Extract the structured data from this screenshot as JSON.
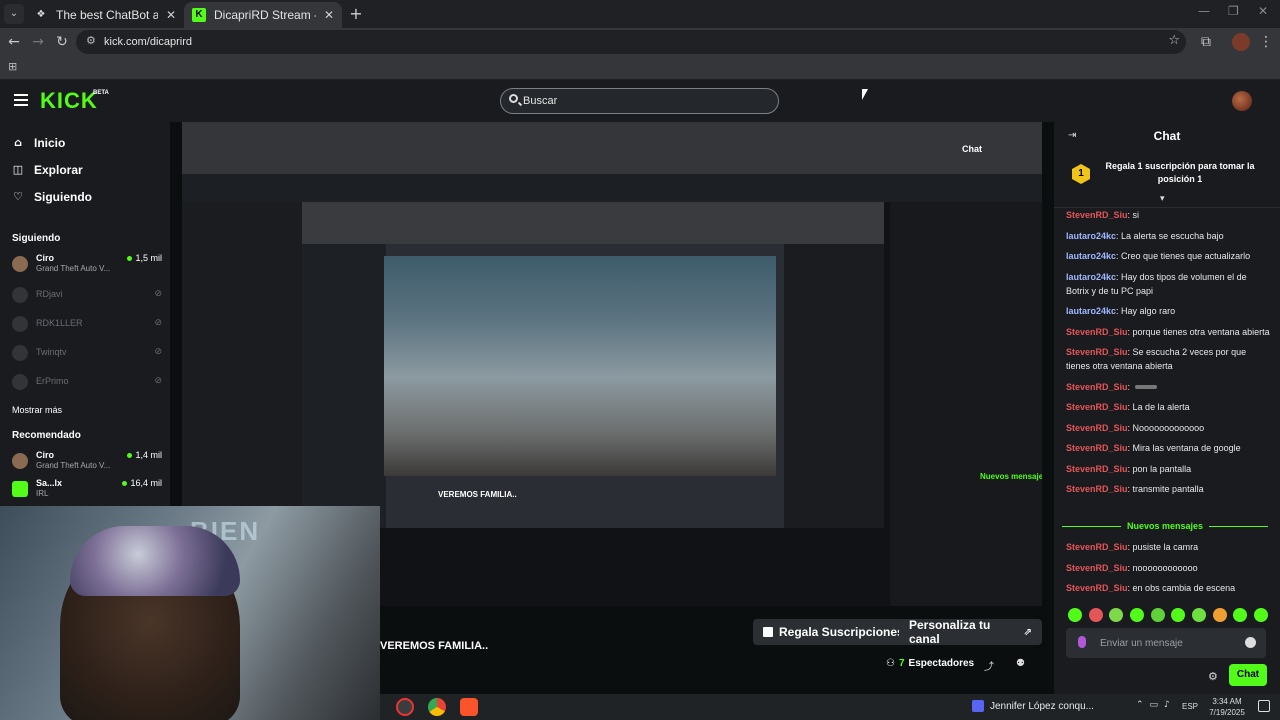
{
  "browser": {
    "tabs": [
      {
        "label": "The best ChatBot and Widgets",
        "close": "✕"
      },
      {
        "label": "DicapriRD Stream - Watch Live",
        "close": "✕"
      }
    ],
    "new_tab": "+",
    "url": "kick.com/dicaprird"
  },
  "header": {
    "logo": "KICK",
    "logo_badge": "BETA",
    "search_placeholder": "Buscar"
  },
  "sidebar": {
    "nav": [
      {
        "label": "Inicio",
        "icon": "home-icon",
        "glyph": "⌂"
      },
      {
        "label": "Explorar",
        "icon": "compass-icon",
        "glyph": "◫"
      },
      {
        "label": "Siguiendo",
        "icon": "heart-icon",
        "glyph": "♡"
      }
    ],
    "following_heading": "Siguiendo",
    "following": [
      {
        "name": "Ciro",
        "game": "Grand Theft Auto V...",
        "viewers": "1,5 mil",
        "live": true
      },
      {
        "name": "RDjavi",
        "live": false
      },
      {
        "name": "RDK1LLER",
        "live": false
      },
      {
        "name": "Twinqtv",
        "live": false
      },
      {
        "name": "ErPrimo",
        "live": false
      }
    ],
    "show_more": "Mostrar más",
    "recommended_heading": "Recomendado",
    "recommended": [
      {
        "name": "Ciro",
        "game": "Grand Theft Auto V...",
        "viewers": "1,4 mil"
      },
      {
        "name": "Sa...lx",
        "game": "IRL",
        "viewers": "16,4 mil"
      }
    ]
  },
  "stream": {
    "title": "VEREMOS FAMILIA..",
    "gift_button": "Regala Suscripciones",
    "customize_button": "Personaliza tu canal",
    "viewers_count": "7",
    "viewers_label": "Espectadores",
    "overlay_text": "BIEN",
    "nested_title": "VEREMOS FAMILIA.."
  },
  "chat": {
    "title": "Chat",
    "pinned_rank": "1",
    "pinned_text": "Regala 1 suscripción para tomar la posición 1",
    "messages": [
      {
        "user": "StevenRD_Siu",
        "color": "red",
        "text": "si"
      },
      {
        "user": "lautaro24kc",
        "color": "blue",
        "text": "La alerta se escucha bajo"
      },
      {
        "user": "lautaro24kc",
        "color": "blue",
        "text": "Creo que tienes que actualizarlo"
      },
      {
        "user": "lautaro24kc",
        "color": "blue",
        "text": "Hay dos tipos de volumen el de Botrix y de tu PC papi"
      },
      {
        "user": "lautaro24kc",
        "color": "blue",
        "text": "Hay algo raro"
      },
      {
        "user": "StevenRD_Siu",
        "color": "red",
        "text": "porque tienes otra ventana abierta"
      },
      {
        "user": "StevenRD_Siu",
        "color": "red",
        "text": "Se escucha 2 veces por que tienes otra ventana abierta"
      },
      {
        "user": "StevenRD_Siu",
        "color": "red",
        "text": ""
      },
      {
        "user": "StevenRD_Siu",
        "color": "red",
        "text": "La de la alerta"
      },
      {
        "user": "StevenRD_Siu",
        "color": "red",
        "text": "Nooooooooooooo"
      },
      {
        "user": "StevenRD_Siu",
        "color": "red",
        "text": "Mira las ventana de google"
      },
      {
        "user": "StevenRD_Siu",
        "color": "red",
        "text": "pon la pantalla"
      },
      {
        "user": "StevenRD_Siu",
        "color": "red",
        "text": "transmite pantalla"
      }
    ],
    "new_messages_label": "Nuevos mensajes",
    "new_messages": [
      {
        "user": "StevenRD_Siu",
        "color": "red",
        "text": "pusiste la camra"
      },
      {
        "user": "StevenRD_Siu",
        "color": "red",
        "text": "noooooooooooo"
      },
      {
        "user": "StevenRD_Siu",
        "color": "red",
        "text": "en obs cambia de escena"
      }
    ],
    "input_placeholder": "Enviar un mensaje",
    "send_button": "Chat"
  },
  "taskbar": {
    "media_title": "Jennifer López conqu...",
    "language": "ESP",
    "time": "3:34 AM",
    "date": "7/19/2025"
  },
  "colors": {
    "accent": "#53fc18",
    "user_red": "#e45558",
    "user_blue": "#a0b7ff",
    "background": "#0b0e0f",
    "panel": "#191b1f"
  }
}
